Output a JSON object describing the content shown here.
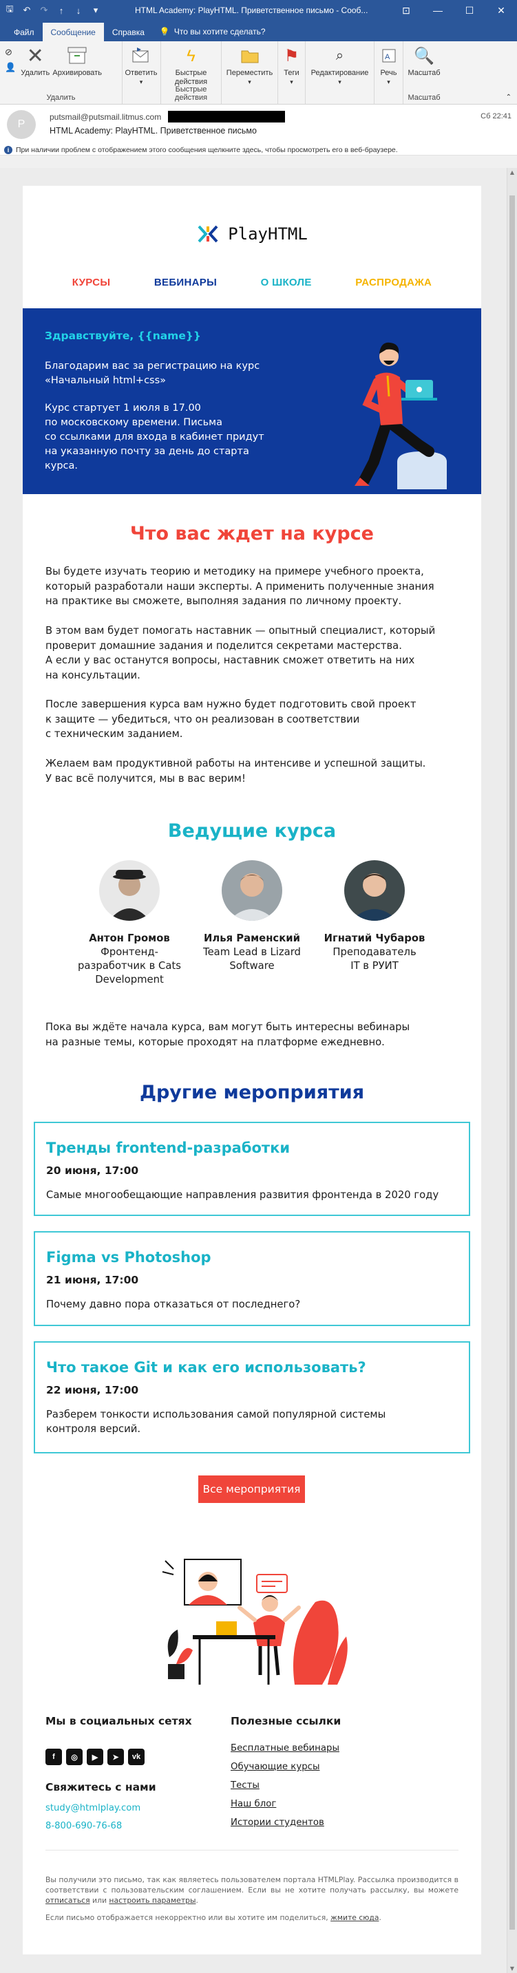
{
  "window": {
    "title": "HTML Academy: PlayHTML. Приветственное письмо  -  Сооб...",
    "controls": [
      "restore-glyph",
      "minimize-glyph",
      "maximize-glyph",
      "close-glyph"
    ]
  },
  "ribbon_tabs": {
    "file": "Файл",
    "message": "Сообщение",
    "help": "Справка",
    "tell_me": "Что вы хотите сделать?"
  },
  "ribbon": {
    "delete": "Удалить",
    "archive": "Архивировать",
    "group_delete": "Удалить",
    "reply": "Ответить",
    "quick_steps_1": "Быстрые",
    "quick_steps_2": "действия",
    "group_quick": "Быстрые действия",
    "move": "Переместить",
    "tags": "Теги",
    "editing": "Редактирование",
    "speech": "Речь",
    "zoom": "Масштаб",
    "group_zoom": "Масштаб"
  },
  "message": {
    "avatar_letter": "P",
    "from": "putsmail@putsmail.litmus.com",
    "subject": "HTML Academy: PlayHTML. Приветственное письмо",
    "date": "Сб 22:41",
    "info": "При наличии проблем с отображением этого сообщения щелкните здесь, чтобы просмотреть его в веб-браузере."
  },
  "email": {
    "logo": "PlayHTML",
    "nav": [
      {
        "label": "КУРСЫ",
        "color": "#f0453a"
      },
      {
        "label": "ВЕБИНАРЫ",
        "color": "#0f3a9b"
      },
      {
        "label": "О ШКОЛЕ",
        "color": "#1ab3c7"
      },
      {
        "label": "РАСПРОДАЖА",
        "color": "#f5b400"
      }
    ],
    "hero": {
      "greeting": "Здравствуйте, {{name}}",
      "p1_line1": "Благодарим вас за регистрацию на курс",
      "p1_line2": "«Начальный html+css»",
      "p2_line1": "Курс стартует 1 июля в 17.00",
      "p2_line2": "по московскому времени. Письма",
      "p2_line3": "со ссылками для входа в кабинет придут",
      "p2_line4": "на указанную почту за день до старта",
      "p2_line5": "курса."
    },
    "course": {
      "title": "Что вас ждет на курсе",
      "para1": [
        "Вы будете изучать теорию и методику на примере учебного проекта,",
        "который разработали наши эксперты. А применить полученные знания",
        "на практике вы сможете, выполняя задания по личному проекту."
      ],
      "para2": [
        "В этом вам будет помогать наставник — опытный специалист, который",
        "проверит домашние задания и поделится секретами мастерства.",
        "А если у вас останутся вопросы, наставник сможет ответить на них",
        "на консультации."
      ],
      "para3": [
        "После завершения курса вам нужно будет подготовить свой проект",
        "к защите — убедиться, что он реализован в соответствии",
        "с техническим заданием."
      ],
      "para4": [
        "Желаем вам продуктивной работы на интенсиве и успешной защиты.",
        "У вас всё получится, мы в вас верим!"
      ]
    },
    "teachers": {
      "title": "Ведущие курса",
      "list": [
        {
          "name": "Антон Громов",
          "role1": "Фронтенд-",
          "role2": "разработчик в Cats",
          "role3": "Development"
        },
        {
          "name": "Илья Раменский",
          "role1": "Team Lead в Lizard",
          "role2": "Software",
          "role3": ""
        },
        {
          "name": "Игнатий Чубаров",
          "role1": "Преподаватель",
          "role2": "IT в РУИТ",
          "role3": ""
        }
      ]
    },
    "webinars_note": [
      "Пока вы ждёте начала курса, вам могут быть интересны вебинары",
      "на разные темы, которые проходят на платформе ежедневно."
    ],
    "events": {
      "title": "Другие мероприятия",
      "list": [
        {
          "title": "Тренды frontend-разработки",
          "date": "20 июня, 17:00",
          "desc1": "Самые многообещающие направления развития фронтенда в 2020 году",
          "desc2": ""
        },
        {
          "title": "Figma vs Photoshop",
          "date": "21 июня, 17:00",
          "desc1": "Почему давно пора отказаться от последнего?",
          "desc2": ""
        },
        {
          "title": "Что такое Git и как его использовать?",
          "date": "22 июня, 17:00",
          "desc1": "Разберем тонкости использования самой популярной системы",
          "desc2": "контроля версий."
        }
      ],
      "all_button": "Все мероприятия"
    },
    "footer": {
      "social_title": "Мы в социальных сетях",
      "social_icons": [
        "f",
        "◎",
        "▶",
        "➤",
        "vk"
      ],
      "contact_title": "Свяжитесь с нами",
      "email": "study@htmlplay.com",
      "phone": "8-800-690-76-68",
      "links_title": "Полезные ссылки",
      "links": [
        "Бесплатные вебинары",
        "Обучающие курсы",
        "Тесты",
        "Наш блог",
        "Истории студентов"
      ],
      "legal1": "Вы получили это письмо, так как являетесь пользователем портала HTMLPlay. Рассылка производится в соответствии с пользовательским соглашением. Если вы не хотите получать рассылку, вы можете",
      "legal1_link": "отписаться",
      "legal1_mid": "или",
      "legal1_link2": "настроить параметры",
      "legal2": "Если письмо отображается некорректно или вы хотите им поделиться,",
      "legal2_link": "жмите сюда"
    }
  }
}
